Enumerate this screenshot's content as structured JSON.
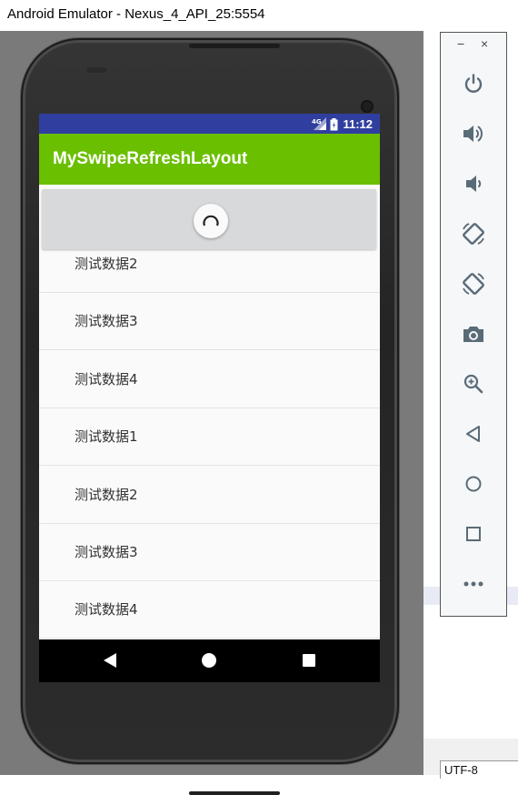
{
  "window": {
    "title": "Android Emulator - Nexus_4_API_25:5554"
  },
  "status_bar": {
    "time": "11:12",
    "network_label": "4G",
    "bg_color": "#303f9f"
  },
  "app_bar": {
    "title": "MySwipeRefreshLayout",
    "bg_color": "#6abf00"
  },
  "list": {
    "rows": [
      {
        "label": "测试数据2"
      },
      {
        "label": "测试数据3"
      },
      {
        "label": "测试数据4"
      },
      {
        "label": "测试数据1"
      },
      {
        "label": "测试数据2"
      },
      {
        "label": "测试数据3"
      },
      {
        "label": "测试数据4"
      }
    ]
  },
  "refresh": {
    "state": "refreshing",
    "icon": "spinner-icon"
  },
  "nav_bar": {
    "back": "nav-back-icon",
    "home": "nav-home-icon",
    "recents": "nav-recents-icon"
  },
  "toolbar": {
    "minimize": "−",
    "close": "×",
    "buttons": [
      {
        "name": "power",
        "icon": "power-icon"
      },
      {
        "name": "volume-up",
        "icon": "volume-up-icon"
      },
      {
        "name": "volume-down",
        "icon": "volume-down-icon"
      },
      {
        "name": "rotate-left",
        "icon": "rotate-left-icon"
      },
      {
        "name": "rotate-right",
        "icon": "rotate-right-icon"
      },
      {
        "name": "screenshot",
        "icon": "camera-icon"
      },
      {
        "name": "zoom",
        "icon": "zoom-in-icon"
      },
      {
        "name": "back",
        "icon": "back-icon"
      },
      {
        "name": "home",
        "icon": "home-icon"
      },
      {
        "name": "overview",
        "icon": "overview-icon"
      },
      {
        "name": "more",
        "icon": "more-icon"
      }
    ]
  },
  "encoding": {
    "label": "UTF-8"
  },
  "colors": {
    "icon": "#5a6b78",
    "list_text": "#333333"
  }
}
